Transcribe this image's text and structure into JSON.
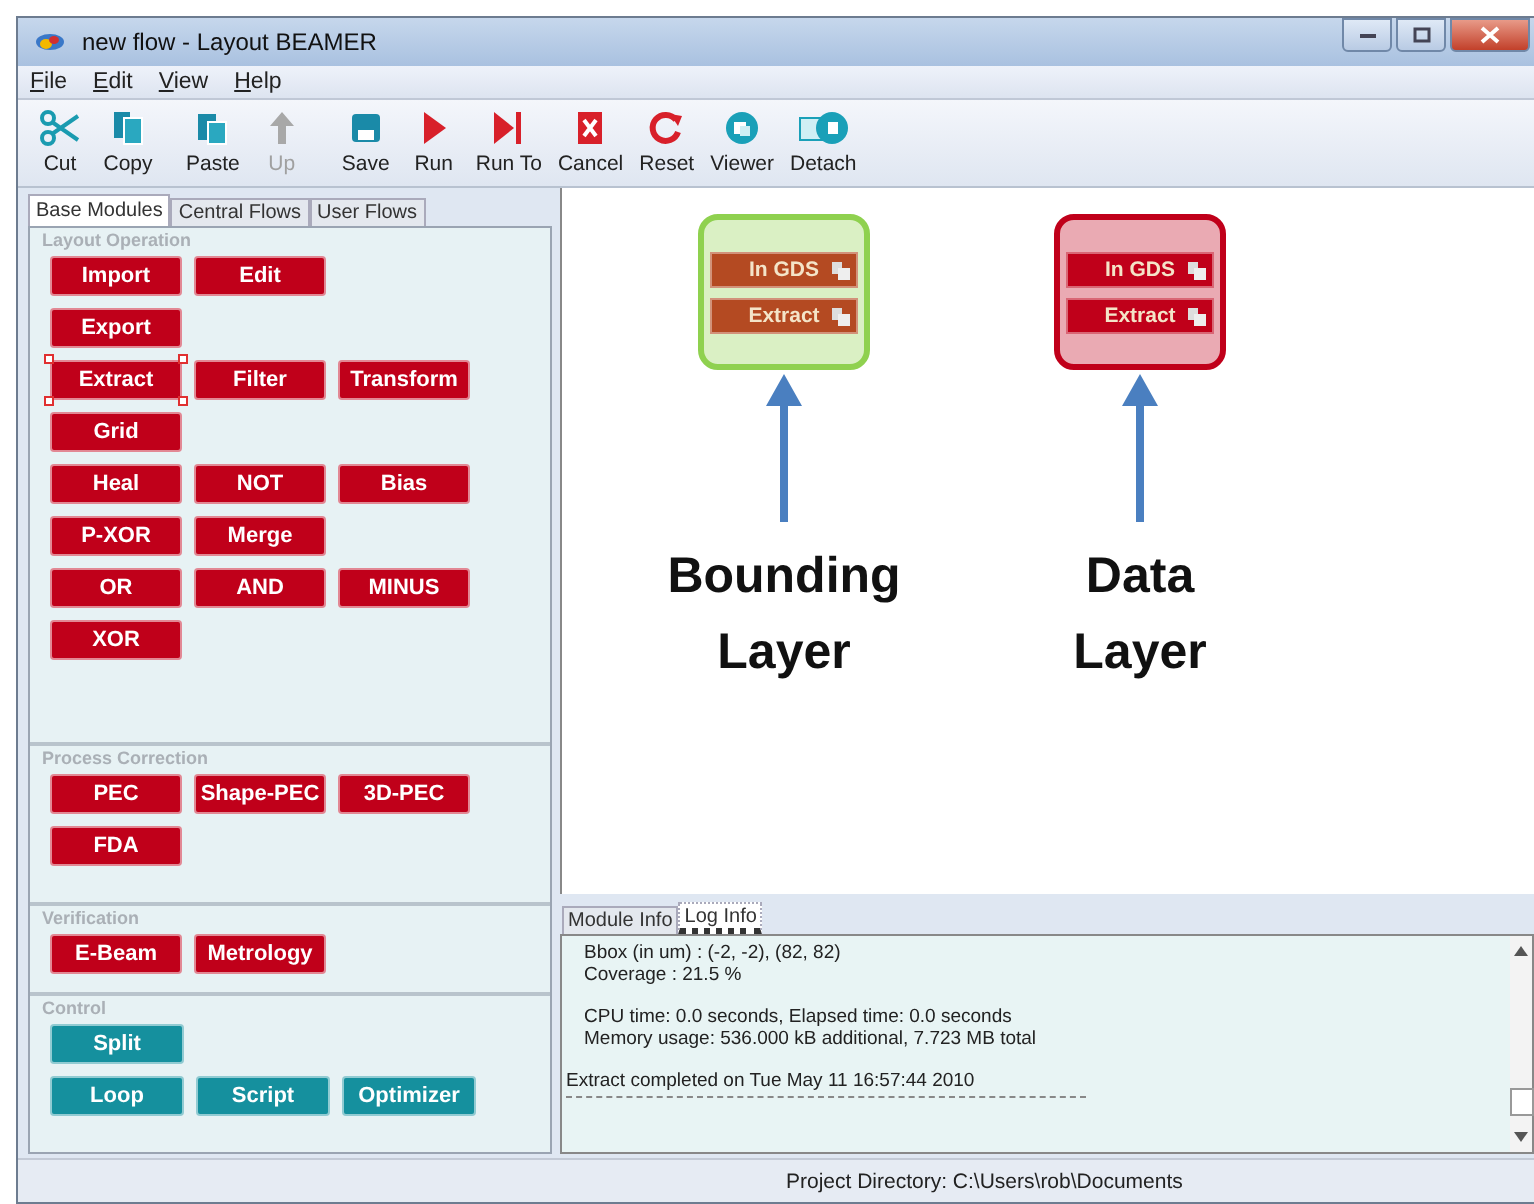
{
  "window": {
    "title": "new flow - Layout BEAMER"
  },
  "menu": [
    "File",
    "Edit",
    "View",
    "Help"
  ],
  "toolbar": [
    {
      "label": "Cut",
      "kind": "cut",
      "disabled": false
    },
    {
      "label": "Copy",
      "kind": "copy",
      "disabled": false
    },
    {
      "label": "Paste",
      "kind": "paste",
      "disabled": false
    },
    {
      "label": "Up",
      "kind": "up",
      "disabled": true
    },
    {
      "label": "Save",
      "kind": "save",
      "disabled": false
    },
    {
      "label": "Run",
      "kind": "run",
      "disabled": false
    },
    {
      "label": "Run To",
      "kind": "runto",
      "disabled": false
    },
    {
      "label": "Cancel",
      "kind": "cancel",
      "disabled": false
    },
    {
      "label": "Reset",
      "kind": "reset",
      "disabled": false
    },
    {
      "label": "Viewer",
      "kind": "viewer",
      "disabled": false
    },
    {
      "label": "Detach",
      "kind": "detach",
      "disabled": false
    }
  ],
  "module_tabs": [
    {
      "label": "Base Modules",
      "selected": true
    },
    {
      "label": "Central Flows",
      "selected": false
    },
    {
      "label": "User Flows",
      "selected": false
    }
  ],
  "sections": [
    {
      "title": "Layout Operation",
      "kind": "operation",
      "rows": [
        [
          {
            "label": "Import",
            "selected": false
          },
          {
            "label": "Edit",
            "selected": false
          }
        ],
        [
          {
            "label": "Export",
            "selected": false
          }
        ],
        [
          {
            "label": "Extract",
            "selected": true
          },
          {
            "label": "Filter",
            "selected": false
          },
          {
            "label": "Transform",
            "selected": false
          }
        ],
        [
          {
            "label": "Grid",
            "selected": false
          }
        ],
        [
          {
            "label": "Heal",
            "selected": false
          },
          {
            "label": "NOT",
            "selected": false
          },
          {
            "label": "Bias",
            "selected": false
          }
        ],
        [
          {
            "label": "P-XOR",
            "selected": false
          },
          {
            "label": "Merge",
            "selected": false
          }
        ],
        [
          {
            "label": "OR",
            "selected": false
          },
          {
            "label": "AND",
            "selected": false
          },
          {
            "label": "MINUS",
            "selected": false
          }
        ],
        [
          {
            "label": "XOR",
            "selected": false
          }
        ]
      ]
    },
    {
      "title": "Process Correction",
      "kind": "operation",
      "rows": [
        [
          {
            "label": "PEC",
            "selected": false
          },
          {
            "label": "Shape-PEC",
            "selected": false
          },
          {
            "label": "3D-PEC",
            "selected": false
          }
        ],
        [
          {
            "label": "FDA",
            "selected": false
          }
        ]
      ]
    },
    {
      "title": "Verification",
      "kind": "operation",
      "rows": [
        [
          {
            "label": "E-Beam",
            "selected": false
          },
          {
            "label": "Metrology",
            "selected": false
          }
        ]
      ]
    },
    {
      "title": "Control",
      "kind": "control",
      "rows": [
        [
          {
            "label": "Split",
            "selected": false
          }
        ],
        [
          {
            "label": "Loop",
            "selected": false
          },
          {
            "label": "Script",
            "selected": false
          },
          {
            "label": "Optimizer",
            "selected": false
          }
        ]
      ]
    }
  ],
  "canvas": {
    "flows": [
      {
        "color": "#8fd14f",
        "blocks": [
          "In GDS",
          "Extract"
        ],
        "caption": [
          "Bounding",
          "Layer"
        ]
      },
      {
        "color": "#c0001a",
        "blocks": [
          "In GDS",
          "Extract"
        ],
        "caption": [
          "Data",
          "Layer"
        ]
      }
    ]
  },
  "info_tabs": [
    {
      "label": "Module Info",
      "selected": false
    },
    {
      "label": "Log Info",
      "selected": true
    }
  ],
  "log": [
    {
      "text": "Bbox (in um) : (-2, -2), (82, 82)",
      "kind": "indent"
    },
    {
      "text": "Coverage : 21.5 %",
      "kind": "indent"
    },
    {
      "text": "CPU time: 0.0 seconds, Elapsed time: 0.0 seconds",
      "kind": "indent"
    },
    {
      "text": "Memory usage: 536.000 kB additional, 7.723 MB total",
      "kind": "indent"
    },
    {
      "text": "Extract completed on Tue May 11 16:57:44 2010",
      "kind": "plain"
    }
  ],
  "status_bar": "Project Directory: C:\\Users\\rob\\Documents"
}
